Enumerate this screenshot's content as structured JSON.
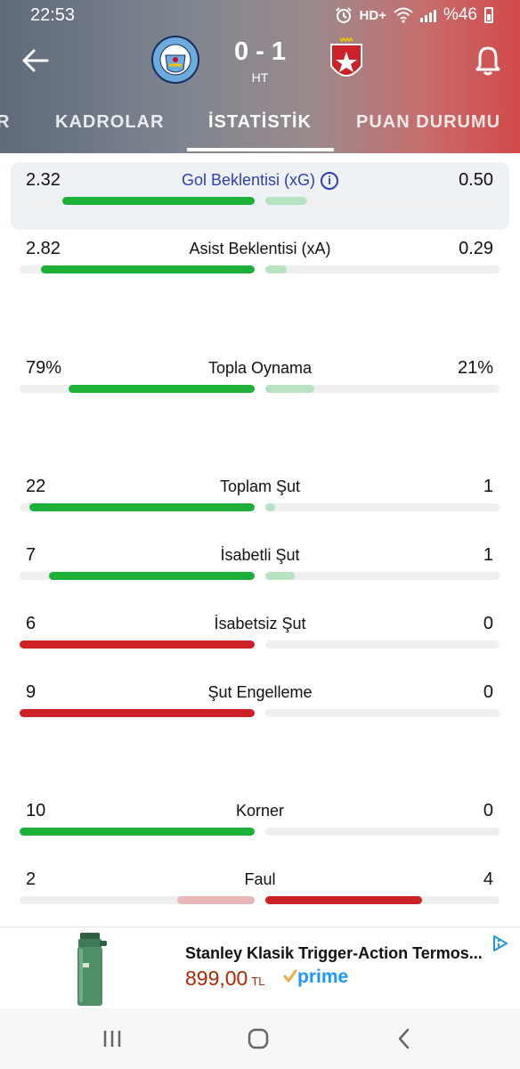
{
  "status_bar": {
    "time": "22:53",
    "network": "HD+",
    "battery": "%46"
  },
  "match": {
    "score": "0 - 1",
    "period": "HT",
    "home_team_crest_text": "MANCHESTER CITY",
    "away_team_crest_text": "ФК"
  },
  "tabs": [
    {
      "label": "R"
    },
    {
      "label": "KADROLAR"
    },
    {
      "label": "İSTATİSTİK",
      "active": true
    },
    {
      "label": "PUAN DURUMU"
    }
  ],
  "stats": [
    {
      "label": "Gol Beklentisi (xG)",
      "home": "2.32",
      "away": "0.50",
      "home_fill": 0.82,
      "away_fill": 0.18,
      "home_color": "#1db13a",
      "away_color": "#b7e3c0"
    },
    {
      "label": "Asist Beklentisi (xA)",
      "home": "2.82",
      "away": "0.29",
      "home_fill": 0.91,
      "away_fill": 0.09,
      "home_color": "#1db13a",
      "away_color": "#b7e3c0"
    },
    {
      "label": "Topla Oynama",
      "home": "79%",
      "away": "21%",
      "home_fill": 0.79,
      "away_fill": 0.21,
      "home_color": "#1db13a",
      "away_color": "#b7e3c0"
    },
    {
      "label": "Toplam Şut",
      "home": "22",
      "away": "1",
      "home_fill": 0.96,
      "away_fill": 0.04,
      "home_color": "#1db13a",
      "away_color": "#b7e3c0"
    },
    {
      "label": "İsabetli Şut",
      "home": "7",
      "away": "1",
      "home_fill": 0.875,
      "away_fill": 0.125,
      "home_color": "#1db13a",
      "away_color": "#b7e3c0"
    },
    {
      "label": "İsabetsiz Şut",
      "home": "6",
      "away": "0",
      "home_fill": 1.0,
      "away_fill": 0.0,
      "home_color": "#cc2127",
      "away_color": "#f2c4c6"
    },
    {
      "label": "Şut Engelleme",
      "home": "9",
      "away": "0",
      "home_fill": 1.0,
      "away_fill": 0.0,
      "home_color": "#cc2127",
      "away_color": "#f2c4c6"
    },
    {
      "label": "Korner",
      "home": "10",
      "away": "0",
      "home_fill": 1.0,
      "away_fill": 0.0,
      "home_color": "#1db13a",
      "away_color": "#b7e3c0"
    },
    {
      "label": "Faul",
      "home": "2",
      "away": "4",
      "home_fill": 0.33,
      "away_fill": 0.67,
      "home_color": "#e9b6b8",
      "away_color": "#cc2127"
    }
  ],
  "ad": {
    "title": "Stanley Klasik Trigger-Action Termos...",
    "price": "899,00",
    "currency": "TL",
    "prime": "prime"
  },
  "colors": {
    "accent_blue": "#2e3fb8",
    "green": "#1db13a",
    "red": "#cc2127"
  }
}
